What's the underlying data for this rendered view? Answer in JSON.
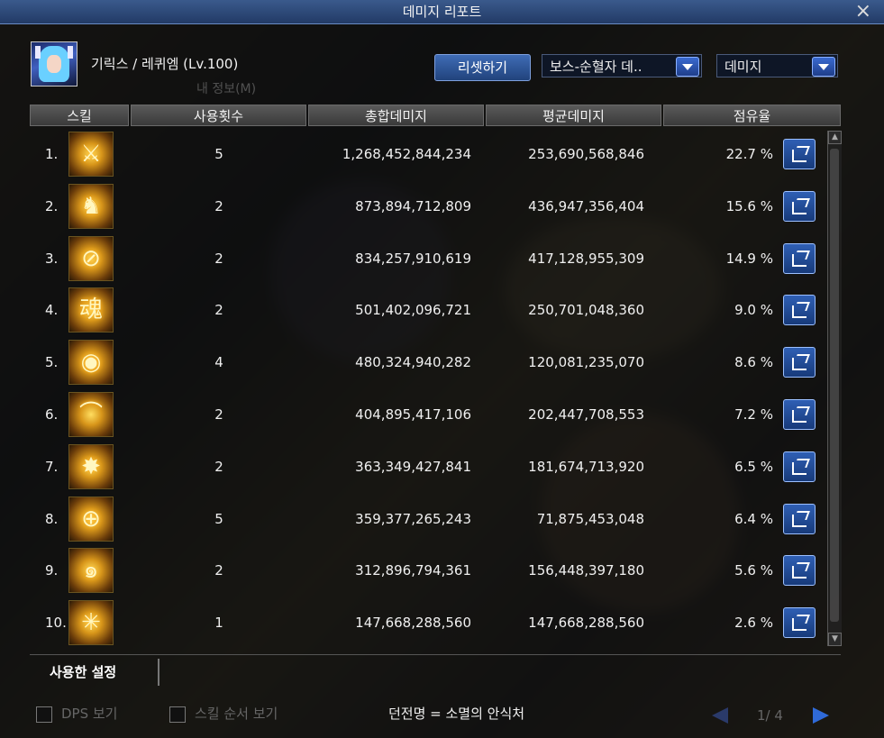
{
  "window": {
    "title": "데미지 리포트",
    "close_label": "×"
  },
  "character": {
    "name": "기릭스 / 레퀴엠 (Lv.100)",
    "icon": "character-portrait"
  },
  "controls": {
    "reset_label": "리셋하기",
    "target_select": "보스-순혈자 데..",
    "metric_select": "데미지"
  },
  "table": {
    "headers": [
      "스킬",
      "사용횟수",
      "총합데미지",
      "평균데미지",
      "점유율"
    ],
    "rows": [
      {
        "rank": "1.",
        "count": "5",
        "total": "1,268,452,844,234",
        "avg": "253,690,568,846",
        "share": "22.7 %",
        "icon": "skill-slash-icon"
      },
      {
        "rank": "2.",
        "count": "2",
        "total": "873,894,712,809",
        "avg": "436,947,356,404",
        "share": "15.6 %",
        "icon": "skill-figure-icon"
      },
      {
        "rank": "3.",
        "count": "2",
        "total": "834,257,910,619",
        "avg": "417,128,955,309",
        "share": "14.9 %",
        "icon": "skill-cross-icon"
      },
      {
        "rank": "4.",
        "count": "2",
        "total": "501,402,096,721",
        "avg": "250,701,048,360",
        "share": "9.0 %",
        "icon": "skill-hanja-icon"
      },
      {
        "rank": "5.",
        "count": "4",
        "total": "480,324,940,282",
        "avg": "120,081,235,070",
        "share": "8.6 %",
        "icon": "skill-eye-icon"
      },
      {
        "rank": "6.",
        "count": "2",
        "total": "404,895,417,106",
        "avg": "202,447,708,553",
        "share": "7.2 %",
        "icon": "skill-arc-icon"
      },
      {
        "rank": "7.",
        "count": "2",
        "total": "363,349,427,841",
        "avg": "181,674,713,920",
        "share": "6.5 %",
        "icon": "skill-burst-icon"
      },
      {
        "rank": "8.",
        "count": "5",
        "total": "359,377,265,243",
        "avg": "71,875,453,048",
        "share": "6.4 %",
        "icon": "skill-orb-icon"
      },
      {
        "rank": "9.",
        "count": "2",
        "total": "312,896,794,361",
        "avg": "156,448,397,180",
        "share": "5.6 %",
        "icon": "skill-vortex-icon"
      },
      {
        "rank": "10.",
        "count": "1",
        "total": "147,668,288,560",
        "avg": "147,668,288,560",
        "share": "2.6 %",
        "icon": "skill-star-icon"
      }
    ]
  },
  "tabs": {
    "active": "사용한 설정"
  },
  "footer": {
    "dps_label": "DPS 보기",
    "skill_order_label": "스킬 순서 보기",
    "dungeon": "던전명 = 소멸의 안식처",
    "page": "1/ 4"
  },
  "colors": {
    "accent": "#2f5fb4",
    "panel": "#080a0e",
    "header": "#4a4a4a"
  }
}
